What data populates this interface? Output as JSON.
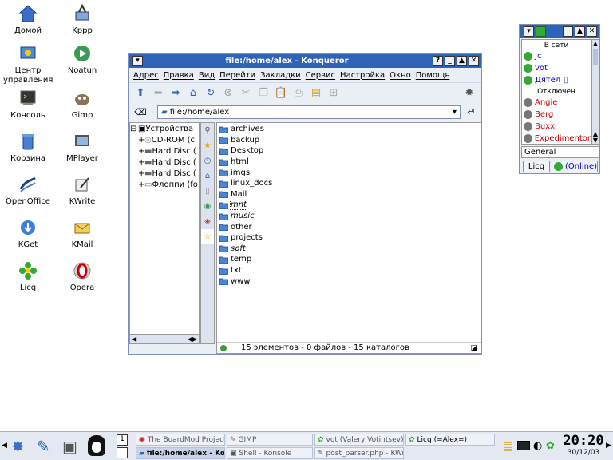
{
  "desktop": {
    "icons": [
      {
        "label": "Домой",
        "icon": "home-icon"
      },
      {
        "label": "Kppp",
        "icon": "kppp-icon"
      },
      {
        "label": "Центр управления",
        "icon": "control-center-icon"
      },
      {
        "label": "Noatun",
        "icon": "noatun-icon"
      },
      {
        "label": "Консоль",
        "icon": "console-icon"
      },
      {
        "label": "Gimp",
        "icon": "gimp-icon"
      },
      {
        "label": "Корзина",
        "icon": "trash-icon"
      },
      {
        "label": "MPlayer",
        "icon": "mplayer-icon"
      },
      {
        "label": "OpenOffice",
        "icon": "openoffice-icon"
      },
      {
        "label": "KWrite",
        "icon": "kwrite-icon"
      },
      {
        "label": "KGet",
        "icon": "kget-icon"
      },
      {
        "label": "KMail",
        "icon": "kmail-icon"
      },
      {
        "label": "Licq",
        "icon": "licq-icon"
      },
      {
        "label": "Opera",
        "icon": "opera-icon"
      }
    ]
  },
  "konqueror": {
    "title": "file:/home/alex - Konqueror",
    "menu": [
      "Адрес",
      "Правка",
      "Вид",
      "Перейти",
      "Закладки",
      "Сервис",
      "Настройка",
      "Окно",
      "Помощь"
    ],
    "url": "file:/home/alex",
    "tree": {
      "root": "Устройства",
      "items": [
        "CD-ROM (c",
        "Hard Disc (",
        "Hard Disc (",
        "Hard Disc (",
        "Флоппи (fo"
      ]
    },
    "files": [
      {
        "name": "archives",
        "italic": false
      },
      {
        "name": "backup",
        "italic": false
      },
      {
        "name": "Desktop",
        "italic": false
      },
      {
        "name": "html",
        "italic": false
      },
      {
        "name": "imgs",
        "italic": false
      },
      {
        "name": "linux_docs",
        "italic": false
      },
      {
        "name": "Mail",
        "italic": false
      },
      {
        "name": "mnt",
        "italic": true
      },
      {
        "name": "music",
        "italic": true
      },
      {
        "name": "other",
        "italic": false
      },
      {
        "name": "projects",
        "italic": false
      },
      {
        "name": "soft",
        "italic": true
      },
      {
        "name": "temp",
        "italic": false
      },
      {
        "name": "txt",
        "italic": false
      },
      {
        "name": "www",
        "italic": false
      }
    ],
    "status": "15 элементов - 0 файлов - 15 каталогов"
  },
  "licq": {
    "online_header": "В сети",
    "online": [
      "Jc",
      "vot",
      "Дятел"
    ],
    "offline_header": "Отключен",
    "offline": [
      "Angie",
      "Berg",
      "Buxx",
      "Expedimentor"
    ],
    "group": "General",
    "button": "Licq",
    "status": "(Online)"
  },
  "taskbar": {
    "tasks_top": [
      "The BoardMod Project -",
      "GIMP",
      "vot (Valery Votintsev)",
      "Licq (=Alex=)"
    ],
    "tasks_bottom": [
      "file:/home/alex - Kon",
      "Shell - Konsole",
      "post_parser.php - KWrite"
    ],
    "clock": "20:20",
    "date": "30/12/03"
  },
  "colors": {
    "title": "#2f63b7",
    "online": "#0000cc",
    "offline": "#cc0000",
    "licq_green": "#33aa33"
  }
}
